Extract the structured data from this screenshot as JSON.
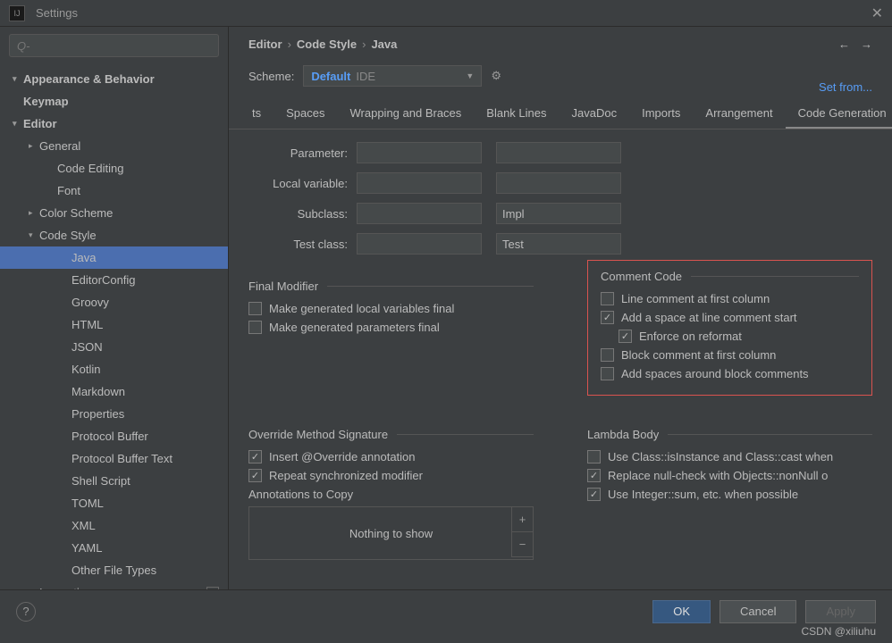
{
  "window": {
    "title": "Settings"
  },
  "search": {
    "placeholder": "Q-"
  },
  "sidebar": {
    "items": [
      {
        "label": "Appearance & Behavior",
        "depth": 0,
        "arrow": "▾",
        "bold": true
      },
      {
        "label": "Keymap",
        "depth": 0,
        "arrow": "",
        "bold": true
      },
      {
        "label": "Editor",
        "depth": 0,
        "arrow": "▾",
        "bold": true
      },
      {
        "label": "General",
        "depth": 1,
        "arrow": "▸"
      },
      {
        "label": "Code Editing",
        "depth": 2,
        "arrow": ""
      },
      {
        "label": "Font",
        "depth": 2,
        "arrow": ""
      },
      {
        "label": "Color Scheme",
        "depth": 1,
        "arrow": "▸"
      },
      {
        "label": "Code Style",
        "depth": 1,
        "arrow": "▾"
      },
      {
        "label": "Java",
        "depth": 3,
        "arrow": "",
        "selected": true
      },
      {
        "label": "EditorConfig",
        "depth": 3,
        "arrow": ""
      },
      {
        "label": "Groovy",
        "depth": 3,
        "arrow": ""
      },
      {
        "label": "HTML",
        "depth": 3,
        "arrow": ""
      },
      {
        "label": "JSON",
        "depth": 3,
        "arrow": ""
      },
      {
        "label": "Kotlin",
        "depth": 3,
        "arrow": ""
      },
      {
        "label": "Markdown",
        "depth": 3,
        "arrow": ""
      },
      {
        "label": "Properties",
        "depth": 3,
        "arrow": ""
      },
      {
        "label": "Protocol Buffer",
        "depth": 3,
        "arrow": ""
      },
      {
        "label": "Protocol Buffer Text",
        "depth": 3,
        "arrow": ""
      },
      {
        "label": "Shell Script",
        "depth": 3,
        "arrow": ""
      },
      {
        "label": "TOML",
        "depth": 3,
        "arrow": ""
      },
      {
        "label": "XML",
        "depth": 3,
        "arrow": ""
      },
      {
        "label": "YAML",
        "depth": 3,
        "arrow": ""
      },
      {
        "label": "Other File Types",
        "depth": 3,
        "arrow": ""
      },
      {
        "label": "Inspections",
        "depth": 1,
        "arrow": "",
        "icon": true
      }
    ]
  },
  "breadcrumb": [
    "Editor",
    "Code Style",
    "Java"
  ],
  "scheme": {
    "label": "Scheme:",
    "value": "Default",
    "suffix": "IDE"
  },
  "setfrom": "Set from...",
  "tabs": [
    "ts",
    "Spaces",
    "Wrapping and Braces",
    "Blank Lines",
    "JavaDoc",
    "Imports",
    "Arrangement",
    "Code Generation"
  ],
  "active_tab": 7,
  "naming": {
    "rows": [
      {
        "label": "Parameter:",
        "v1": "",
        "v2": ""
      },
      {
        "label": "Local variable:",
        "v1": "",
        "v2": ""
      },
      {
        "label": "Subclass:",
        "v1": "",
        "v2": "Impl"
      },
      {
        "label": "Test class:",
        "v1": "",
        "v2": "Test"
      }
    ]
  },
  "final_modifier": {
    "title": "Final Modifier",
    "items": [
      {
        "label": "Make generated local variables final",
        "checked": false
      },
      {
        "label": "Make generated parameters final",
        "checked": false
      }
    ]
  },
  "comment_code": {
    "title": "Comment Code",
    "items": [
      {
        "label": "Line comment at first column",
        "checked": false,
        "indent": false
      },
      {
        "label": "Add a space at line comment start",
        "checked": true,
        "indent": false
      },
      {
        "label": "Enforce on reformat",
        "checked": true,
        "indent": true
      },
      {
        "label": "Block comment at first column",
        "checked": false,
        "indent": false
      },
      {
        "label": "Add spaces around block comments",
        "checked": false,
        "indent": false
      }
    ]
  },
  "override": {
    "title": "Override Method Signature",
    "items": [
      {
        "label": "Insert @Override annotation",
        "checked": true
      },
      {
        "label": "Repeat synchronized modifier",
        "checked": true
      }
    ],
    "annot_label": "Annotations to Copy",
    "annot_empty": "Nothing to show"
  },
  "lambda": {
    "title": "Lambda Body",
    "items": [
      {
        "label": "Use Class::isInstance and Class::cast when",
        "checked": false
      },
      {
        "label": "Replace null-check with Objects::nonNull o",
        "checked": true
      },
      {
        "label": "Use Integer::sum, etc. when possible",
        "checked": true
      }
    ]
  },
  "footer": {
    "ok": "OK",
    "cancel": "Cancel",
    "apply": "Apply"
  },
  "watermark": "CSDN @xiliuhu"
}
